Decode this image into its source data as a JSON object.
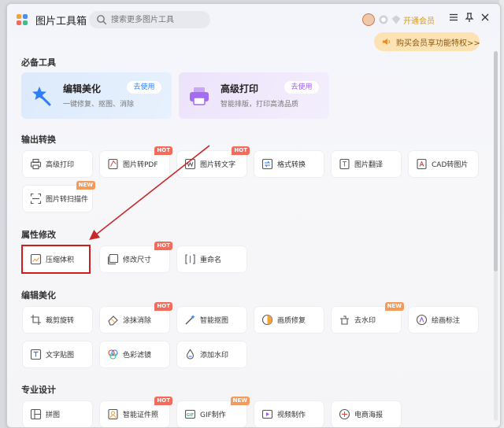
{
  "app": {
    "title": "图片工具箱",
    "search_placeholder": "搜索更多图片工具",
    "vip_link": "开通会员",
    "promo_text": "购买会员享功能特权>>"
  },
  "colors": {
    "accent_blue": "#2d7ff9",
    "hot_badge": "#f26b5b",
    "new_badge": "#f29b5b",
    "highlight_red": "#d01c1c",
    "promo_bg": "#fde3b4"
  },
  "sections": {
    "essential": {
      "title": "必备工具",
      "cards": [
        {
          "title": "编辑美化",
          "desc": "一键修复、抠图、消除",
          "button": "去使用",
          "icon": "magic-wand-star-icon"
        },
        {
          "title": "高级打印",
          "desc": "智能排版，打印高清品质",
          "button": "去使用",
          "icon": "printer-icon"
        }
      ]
    },
    "output": {
      "title": "输出转换",
      "items": [
        {
          "label": "高级打印",
          "icon": "printer-icon",
          "badge": ""
        },
        {
          "label": "图片转PDF",
          "icon": "pdf-icon",
          "badge": "HOT"
        },
        {
          "label": "图片转文字",
          "icon": "image-text-icon",
          "badge": "HOT"
        },
        {
          "label": "格式转换",
          "icon": "format-convert-icon",
          "badge": ""
        },
        {
          "label": "图片翻译",
          "icon": "translate-icon",
          "badge": ""
        },
        {
          "label": "CAD转图片",
          "icon": "cad-icon",
          "badge": ""
        },
        {
          "label": "图片转扫描件",
          "icon": "scan-icon",
          "badge": "NEW"
        }
      ]
    },
    "attributes": {
      "title": "属性修改",
      "items": [
        {
          "label": "压缩体积",
          "icon": "compress-icon",
          "badge": ""
        },
        {
          "label": "修改尺寸",
          "icon": "resize-icon",
          "badge": "HOT"
        },
        {
          "label": "重命名",
          "icon": "rename-icon",
          "badge": ""
        }
      ]
    },
    "edit": {
      "title": "编辑美化",
      "items": [
        {
          "label": "裁剪旋转",
          "icon": "crop-icon",
          "badge": ""
        },
        {
          "label": "涂抹消除",
          "icon": "eraser-icon",
          "badge": "HOT"
        },
        {
          "label": "智能抠图",
          "icon": "cutout-icon",
          "badge": ""
        },
        {
          "label": "画质修复",
          "icon": "quality-repair-icon",
          "badge": ""
        },
        {
          "label": "去水印",
          "icon": "remove-watermark-icon",
          "badge": "NEW"
        },
        {
          "label": "绘画标注",
          "icon": "draw-annotate-icon",
          "badge": ""
        },
        {
          "label": "文字贴图",
          "icon": "text-sticker-icon",
          "badge": ""
        },
        {
          "label": "色彩滤镜",
          "icon": "color-filter-icon",
          "badge": ""
        },
        {
          "label": "添加水印",
          "icon": "add-watermark-icon",
          "badge": ""
        }
      ]
    },
    "pro": {
      "title": "专业设计",
      "items": [
        {
          "label": "拼图",
          "icon": "collage-icon",
          "badge": ""
        },
        {
          "label": "智能证件照",
          "icon": "id-photo-icon",
          "badge": "HOT"
        },
        {
          "label": "GIF制作",
          "icon": "gif-icon",
          "badge": "NEW"
        },
        {
          "label": "视频制作",
          "icon": "video-icon",
          "badge": ""
        },
        {
          "label": "电商海报",
          "icon": "poster-icon",
          "badge": ""
        }
      ]
    }
  }
}
